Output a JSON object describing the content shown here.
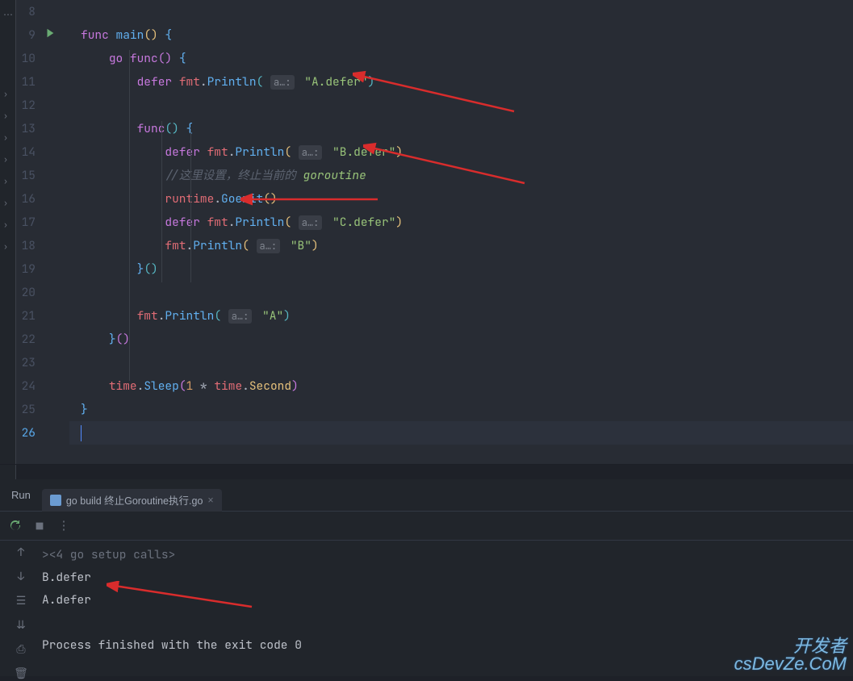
{
  "editor": {
    "lines": [
      {
        "num": "8",
        "code": ""
      },
      {
        "num": "9",
        "run": true,
        "tokens": [
          {
            "t": "func ",
            "c": "kw"
          },
          {
            "t": "main",
            "c": "fn"
          },
          {
            "t": "()",
            "c": "paren-y"
          },
          {
            "t": " {",
            "c": "brace-b"
          }
        ]
      },
      {
        "num": "10",
        "tokens": [
          {
            "pad": 4
          },
          {
            "t": "go func",
            "c": "kw"
          },
          {
            "t": "()",
            "c": "paren-m"
          },
          {
            "t": " {",
            "c": "brace-b"
          }
        ]
      },
      {
        "num": "11",
        "tokens": [
          {
            "pad": 8
          },
          {
            "t": "defer ",
            "c": "kw"
          },
          {
            "t": "fmt",
            "c": "ident"
          },
          {
            "t": ".",
            "c": "punc"
          },
          {
            "t": "Println",
            "c": "fn"
          },
          {
            "t": "(",
            "c": "paren-b"
          },
          {
            "hint": "a…:"
          },
          {
            "t": "\"A.defer\"",
            "c": "str"
          },
          {
            "t": ")",
            "c": "paren-b"
          }
        ]
      },
      {
        "num": "12",
        "code": ""
      },
      {
        "num": "13",
        "tokens": [
          {
            "pad": 8
          },
          {
            "t": "func",
            "c": "kw"
          },
          {
            "t": "()",
            "c": "paren-b"
          },
          {
            "t": " {",
            "c": "brace-b"
          }
        ]
      },
      {
        "num": "14",
        "tokens": [
          {
            "pad": 12
          },
          {
            "t": "defer ",
            "c": "kw"
          },
          {
            "t": "fmt",
            "c": "ident"
          },
          {
            "t": ".",
            "c": "punc"
          },
          {
            "t": "Println",
            "c": "fn"
          },
          {
            "t": "(",
            "c": "paren-y"
          },
          {
            "hint": "a…:"
          },
          {
            "t": "\"B.defer\"",
            "c": "str"
          },
          {
            "t": ")",
            "c": "paren-y"
          }
        ]
      },
      {
        "num": "15",
        "tokens": [
          {
            "pad": 12
          },
          {
            "t": "//这里设置，终止当前的 ",
            "c": "cmt"
          },
          {
            "t": "goroutine",
            "c": "cmt-kw"
          }
        ]
      },
      {
        "num": "16",
        "tokens": [
          {
            "pad": 12
          },
          {
            "t": "runtime",
            "c": "ident"
          },
          {
            "t": ".",
            "c": "punc"
          },
          {
            "t": "Goexit",
            "c": "fn"
          },
          {
            "t": "()",
            "c": "paren-y"
          }
        ]
      },
      {
        "num": "17",
        "tokens": [
          {
            "pad": 12
          },
          {
            "t": "defer ",
            "c": "kw"
          },
          {
            "t": "fmt",
            "c": "ident"
          },
          {
            "t": ".",
            "c": "punc"
          },
          {
            "t": "Println",
            "c": "fn"
          },
          {
            "t": "(",
            "c": "paren-y"
          },
          {
            "hint": "a…:"
          },
          {
            "t": "\"C.defer\"",
            "c": "str"
          },
          {
            "t": ")",
            "c": "paren-y"
          }
        ]
      },
      {
        "num": "18",
        "tokens": [
          {
            "pad": 12
          },
          {
            "t": "fmt",
            "c": "ident"
          },
          {
            "t": ".",
            "c": "punc"
          },
          {
            "t": "Println",
            "c": "fn"
          },
          {
            "t": "(",
            "c": "paren-y"
          },
          {
            "hint": "a…:"
          },
          {
            "t": "\"B\"",
            "c": "str"
          },
          {
            "t": ")",
            "c": "paren-y"
          }
        ]
      },
      {
        "num": "19",
        "tokens": [
          {
            "pad": 8
          },
          {
            "t": "}",
            "c": "brace-b"
          },
          {
            "t": "()",
            "c": "paren-b"
          }
        ]
      },
      {
        "num": "20",
        "code": ""
      },
      {
        "num": "21",
        "tokens": [
          {
            "pad": 8
          },
          {
            "t": "fmt",
            "c": "ident"
          },
          {
            "t": ".",
            "c": "punc"
          },
          {
            "t": "Println",
            "c": "fn"
          },
          {
            "t": "(",
            "c": "paren-b"
          },
          {
            "hint": "a…:"
          },
          {
            "t": "\"A\"",
            "c": "str"
          },
          {
            "t": ")",
            "c": "paren-b"
          }
        ]
      },
      {
        "num": "22",
        "tokens": [
          {
            "pad": 4
          },
          {
            "t": "}",
            "c": "brace-b"
          },
          {
            "t": "()",
            "c": "paren-m"
          }
        ]
      },
      {
        "num": "23",
        "code": ""
      },
      {
        "num": "24",
        "tokens": [
          {
            "pad": 4
          },
          {
            "t": "time",
            "c": "ident"
          },
          {
            "t": ".",
            "c": "punc"
          },
          {
            "t": "Sleep",
            "c": "fn"
          },
          {
            "t": "(",
            "c": "paren-m"
          },
          {
            "t": "1",
            "c": "num"
          },
          {
            "t": " * ",
            "c": "punc"
          },
          {
            "t": "time",
            "c": "ident"
          },
          {
            "t": ".",
            "c": "punc"
          },
          {
            "t": "Second",
            "c": "member"
          },
          {
            "t": ")",
            "c": "paren-m"
          }
        ]
      },
      {
        "num": "25",
        "tokens": [
          {
            "t": "}",
            "c": "brace-b"
          }
        ]
      },
      {
        "num": "26",
        "current": true,
        "cursor": true,
        "code": ""
      }
    ]
  },
  "panel": {
    "run_label": "Run",
    "tab_label": "go build 终止Goroutine执行.go",
    "output_fold": "><4 go setup calls>",
    "output_lines": [
      "B.defer",
      "A.defer",
      "",
      "Process finished with the exit code 0"
    ]
  },
  "watermark": {
    "line1": "开发者",
    "line2": "csDevZe.CoM"
  }
}
